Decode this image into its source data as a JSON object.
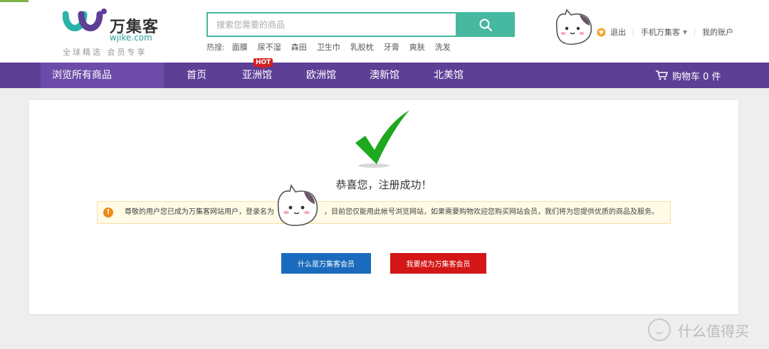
{
  "colors": {
    "nav": "#5e3f96",
    "accent": "#46b8a0",
    "blue_button": "#1a6bbd",
    "red_button": "#d41616",
    "check": "#1ea81e"
  },
  "header": {
    "logo": {
      "name": "万集客",
      "domain": "wjike.com",
      "slogan": "全球精选 会员专享"
    },
    "search": {
      "placeholder": "搜索您需要的商品",
      "icon": "search-icon"
    },
    "hot": {
      "label": "热搜:",
      "words": [
        "面膜",
        "尿不湿",
        "森田",
        "卫生巾",
        "乳胶枕",
        "牙膏",
        "爽肤",
        "洗发"
      ]
    },
    "user_links": {
      "logout": "退出",
      "mobile": "手机万集客",
      "account": "我的账户"
    }
  },
  "nav": {
    "all_products": "浏览所有商品",
    "items": [
      "首页",
      "亚洲馆",
      "欧洲馆",
      "澳新馆",
      "北美馆"
    ],
    "hot_badge": "HOT",
    "cart": "购物车 0 件"
  },
  "main": {
    "title": "恭喜您，注册成功！",
    "notice_a": "尊敬的用户您已成为万集客网站用户，登录名为",
    "notice_b": "，目前您仅能用此帐号浏览网站，如果需要购物欢迎您购买网站会员，我们将为您提供优质的商品及服务。",
    "btn_what": "什么是万集客会员",
    "btn_become": "我要成为万集客会员"
  },
  "watermark": "什么值得买"
}
